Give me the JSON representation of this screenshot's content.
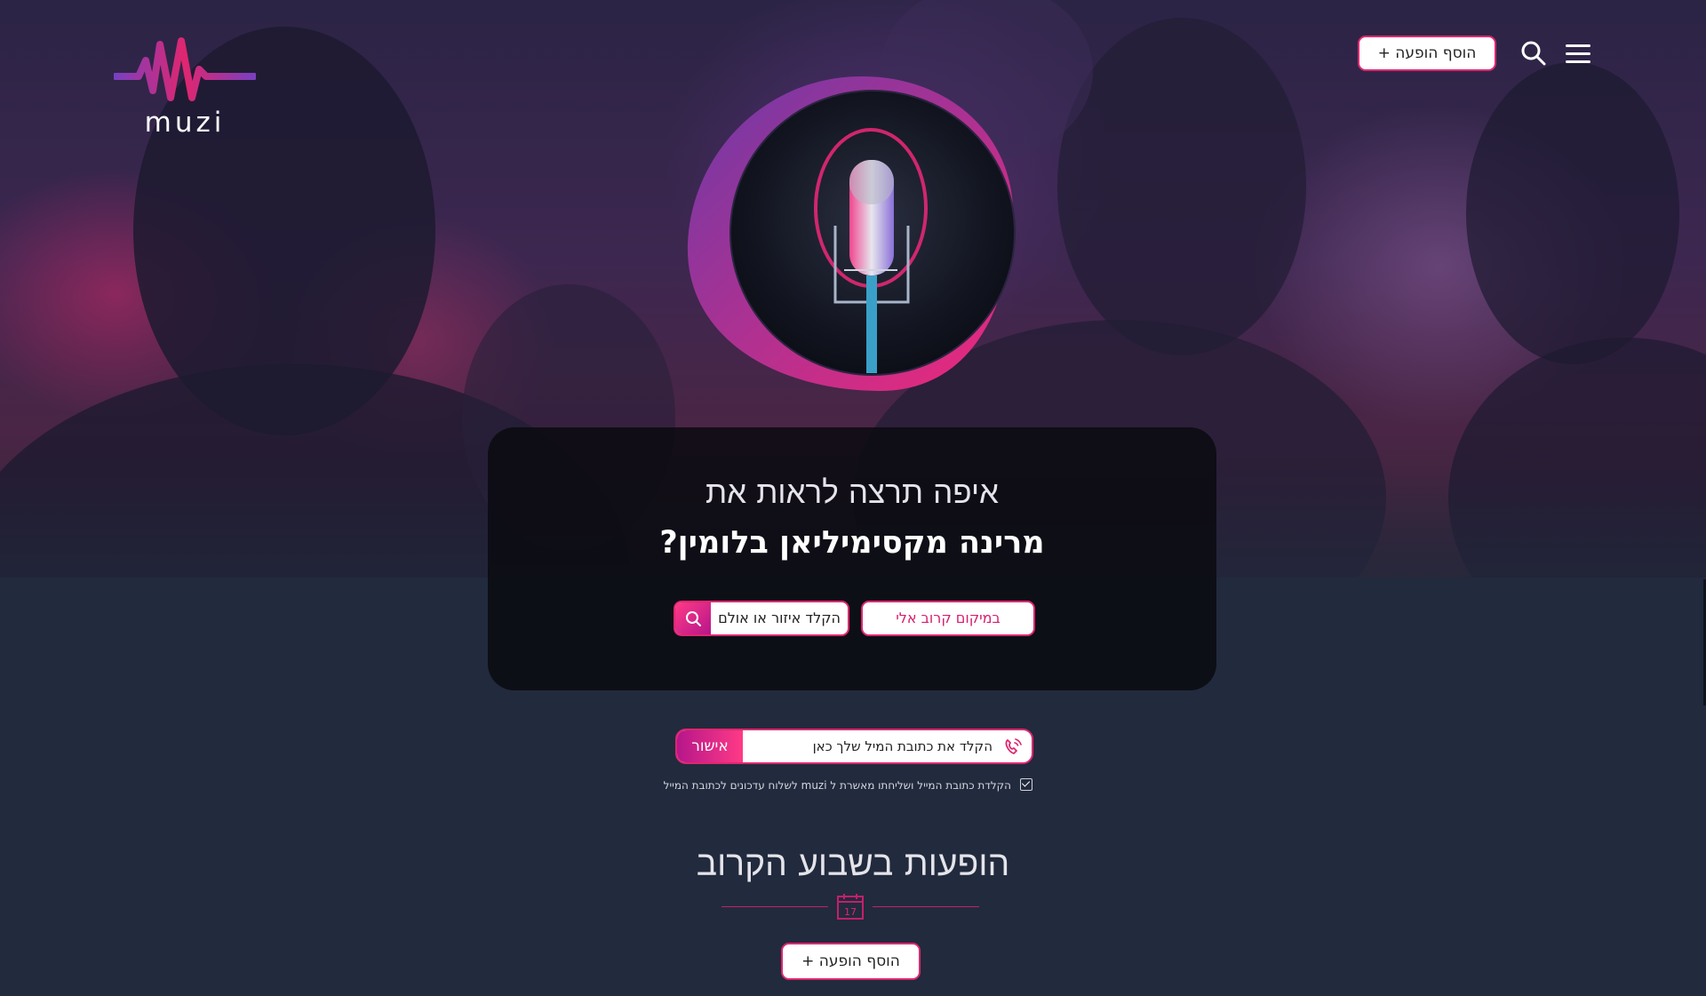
{
  "brand": {
    "name": "muzi"
  },
  "header": {
    "add_show_label": "+ הוסף הופעה"
  },
  "hero_panel": {
    "subtitle": "איפה תרצה לראות את",
    "artist_question": "מרינה מקסימיליאן בלומין?",
    "near_me_label": "במיקום קרוב אלי",
    "area_placeholder": "הקלד איזור או אולם"
  },
  "newsletter": {
    "email_placeholder": "הקלד את כתובת המיל שלך כאן",
    "submit_label": "אישור",
    "consent_text": "הקלדת כתובת המייל ושליחתו מאשרת ל muzi לשלוח עדכונים לכתובת המייל",
    "consent_checked": true
  },
  "upcoming": {
    "title": "הופעות בשבוע הקרוב",
    "calendar_day": "17",
    "add_show_label": "+ הוסף הופעה"
  },
  "colors": {
    "accent": "#e0266f",
    "accent_dark": "#b6168a",
    "page_bg": "#222a3d"
  },
  "icons": [
    "muzi-logo",
    "search-icon",
    "menu-icon",
    "microphone-avatar",
    "search-icon",
    "phone-icon",
    "checkbox-icon",
    "calendar-icon"
  ]
}
